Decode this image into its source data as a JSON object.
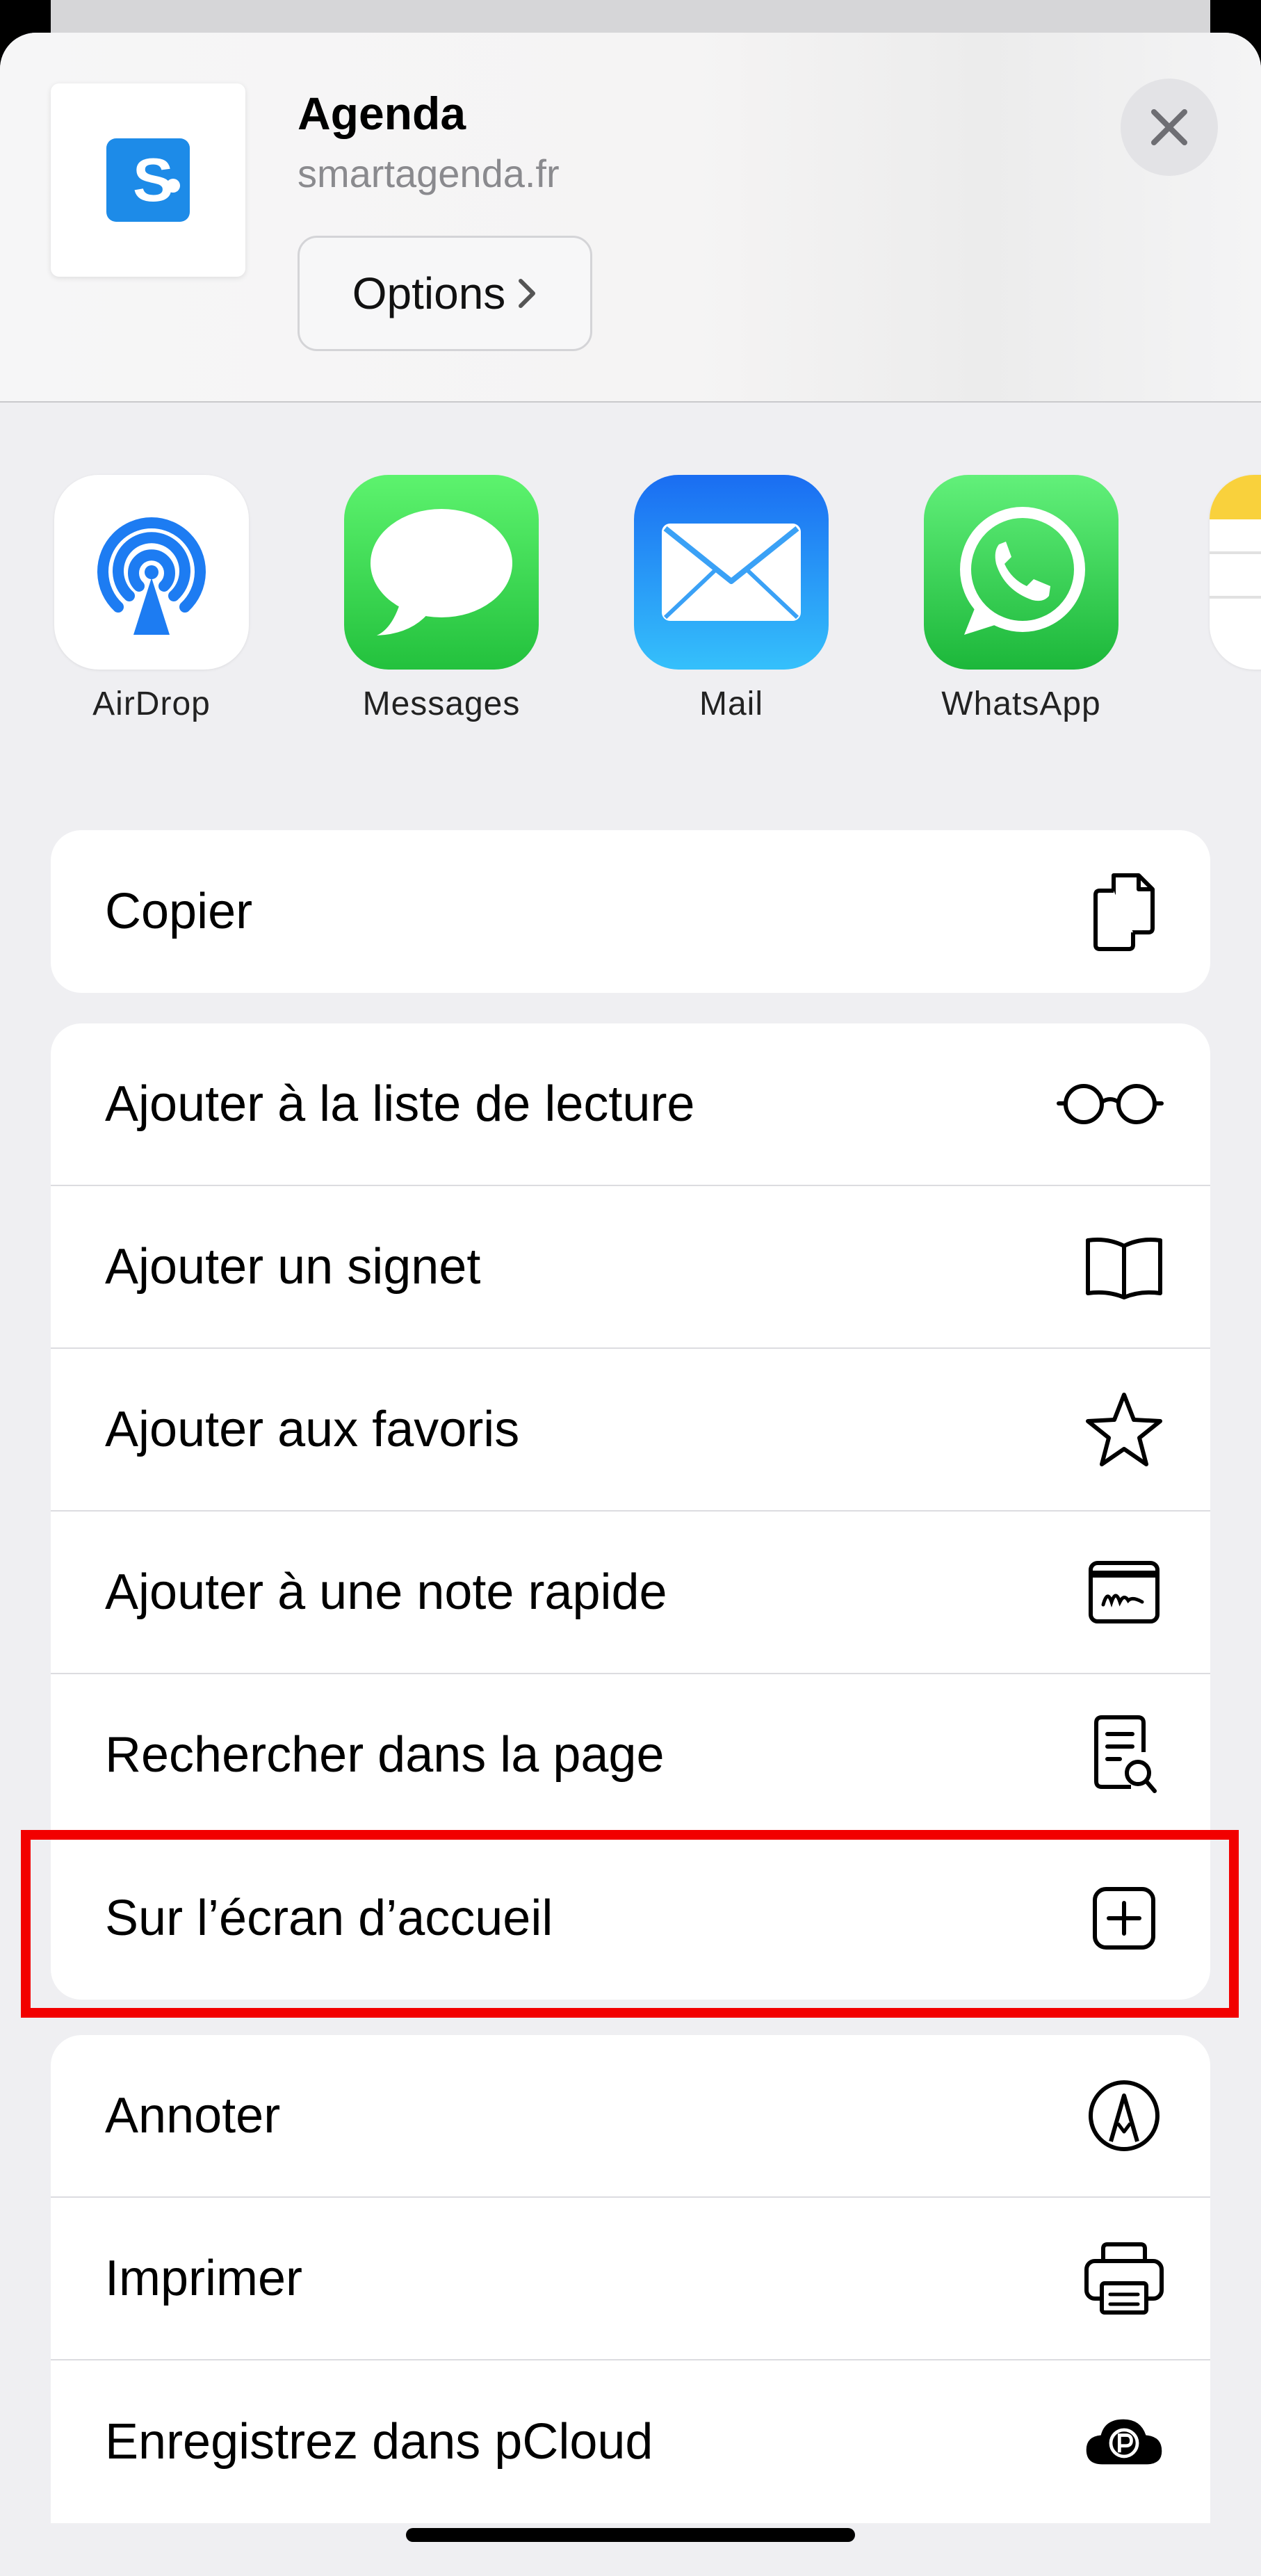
{
  "header": {
    "title": "Agenda",
    "url": "smartagenda.fr",
    "options_label": "Options",
    "app_icon": "smartagenda-logo",
    "close_icon": "close-icon"
  },
  "share_targets": [
    {
      "label": "AirDrop",
      "icon": "airdrop-icon"
    },
    {
      "label": "Messages",
      "icon": "messages-icon"
    },
    {
      "label": "Mail",
      "icon": "mail-icon"
    },
    {
      "label": "WhatsApp",
      "icon": "whatsapp-icon"
    }
  ],
  "actions": {
    "group1": [
      {
        "label": "Copier",
        "icon": "copy-icon"
      }
    ],
    "group2": [
      {
        "label": "Ajouter à la liste de lecture",
        "icon": "glasses-icon"
      },
      {
        "label": "Ajouter un signet",
        "icon": "book-icon"
      },
      {
        "label": "Ajouter aux favoris",
        "icon": "star-icon"
      },
      {
        "label": "Ajouter à une note rapide",
        "icon": "quick-note-icon"
      },
      {
        "label": "Rechercher dans la page",
        "icon": "find-in-page-icon"
      },
      {
        "label": "Sur l’écran d’accueil",
        "icon": "add-square-icon"
      }
    ],
    "group3": [
      {
        "label": "Annoter",
        "icon": "markup-icon"
      },
      {
        "label": "Imprimer",
        "icon": "printer-icon"
      },
      {
        "label": "Enregistrez dans pCloud",
        "icon": "pcloud-icon"
      }
    ]
  },
  "colors": {
    "highlight": "#f20000",
    "sheet_background": "#efeff2",
    "messages_green": "#33c748",
    "mail_blue": "#1f8ef2",
    "whatsapp_green": "#2bd24d",
    "airdrop_blue": "#1d7cf2",
    "logo_blue": "#1d8be8"
  }
}
